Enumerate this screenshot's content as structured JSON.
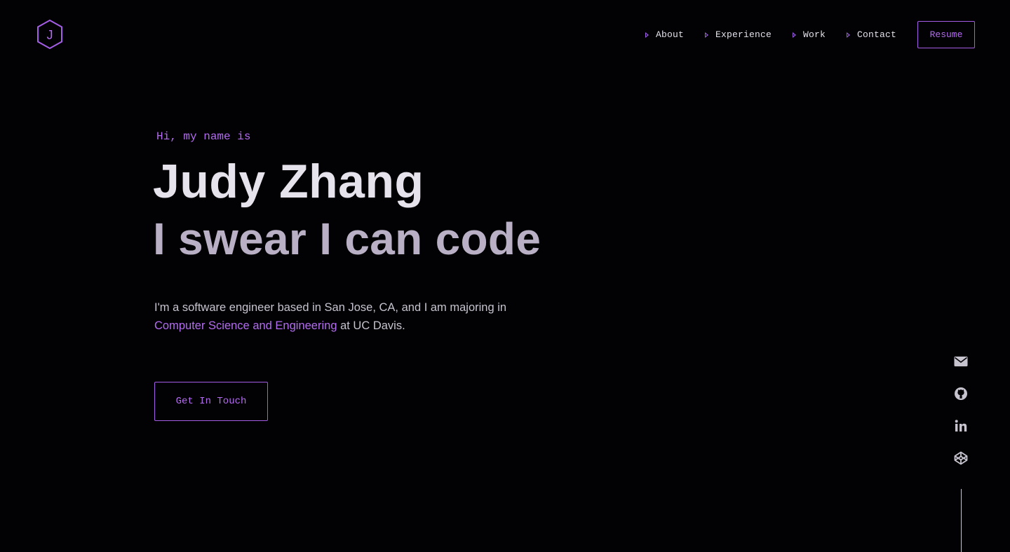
{
  "logo": {
    "letter": "J"
  },
  "nav": {
    "items": [
      {
        "label": "About"
      },
      {
        "label": "Experience"
      },
      {
        "label": "Work"
      },
      {
        "label": "Contact"
      }
    ],
    "resume_label": "Resume"
  },
  "hero": {
    "intro": "Hi, my name is",
    "name": "Judy Zhang",
    "tagline": "I swear I can code",
    "bio_before": "I'm a software engineer based in San Jose, CA, and I am majoring in ",
    "bio_link": "Computer Science and Engineering",
    "bio_after": " at UC Davis.",
    "cta_label": "Get In Touch"
  },
  "social": {
    "icons": [
      "mail-icon",
      "github-icon",
      "linkedin-icon",
      "codepen-icon"
    ]
  },
  "colors": {
    "background": "#020104",
    "accent": "#b46cf0",
    "heading": "#e6e3ec",
    "subheading": "#b9b0c6",
    "body_text": "#c7c4cf"
  }
}
